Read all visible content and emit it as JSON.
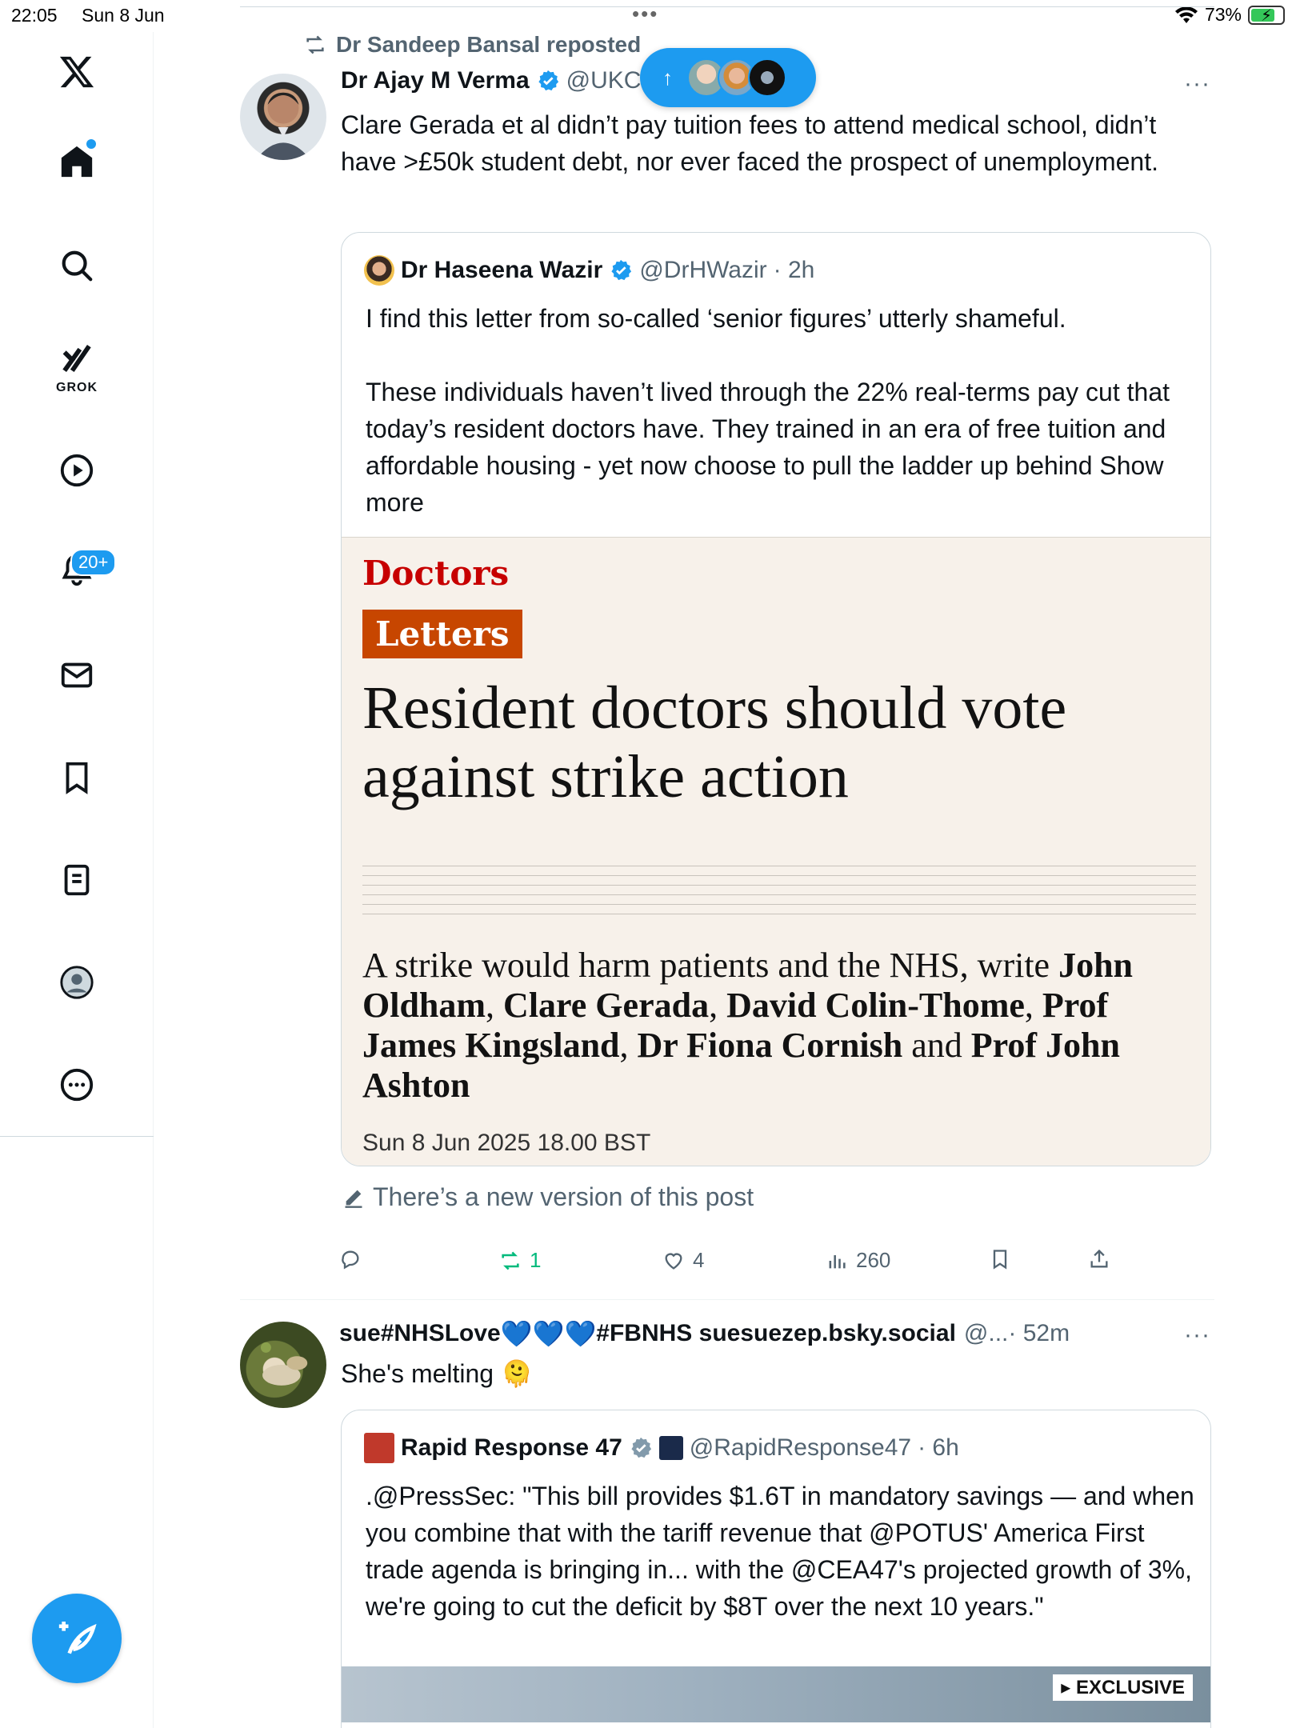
{
  "status_bar": {
    "time": "22:05",
    "date": "Sun 8 Jun",
    "battery": "73%"
  },
  "sidebar": {
    "grok_label": "GROK",
    "notifications_badge": "20+"
  },
  "new_posts_pill": {
    "arrow": "↑"
  },
  "post1": {
    "repost_label": "Dr Sandeep Bansal reposted",
    "author_name": "Dr Ajay M Verma",
    "author_handle": "@UKC",
    "more": "···",
    "text": "Clare Gerada et al didn’t pay tuition fees to attend medical school, didn’t have >£50k student debt, nor ever faced the prospect of unemployment.",
    "quote": {
      "author_name": "Dr Haseena Wazir",
      "author_handle": "@DrHWazir",
      "time": "· 2h",
      "paragraph1": "I find this letter from so-called ‘senior figures’ utterly shameful.",
      "paragraph2": "These individuals haven’t lived through the 22% real-terms pay cut that today’s resident doctors have. They trained in an era of free tuition and affordable housing - yet now choose to pull the ladder up behind",
      "show_more": "Show more",
      "article": {
        "section": "Doctors",
        "tag": "Letters",
        "headline": "Resident doctors should vote against strike action",
        "standfirst_lead": "A strike would harm patients and the NHS, write",
        "authors": [
          "John Oldham",
          "Clare Gerada",
          "David Colin-Thome",
          "Prof James Kingsland",
          "Dr Fiona Cornish",
          "Prof John Ashton"
        ],
        "joiner_comma": ",",
        "joiner_and": "and",
        "date": "Sun 8 Jun 2025 18.00 BST"
      }
    },
    "edit_note": "There’s a new version of this post",
    "actions": {
      "reposts": "1",
      "likes": "4",
      "views": "260"
    }
  },
  "post2": {
    "author_name_prefix": "sue#NHSLove",
    "author_name_suffix": "#FBNHS suesuezep.bsky.social",
    "author_handle": "@...",
    "time": "· 52m",
    "more": "···",
    "text": "She's melting",
    "emoji": "🫠",
    "quote": {
      "author_name": "Rapid Response 47",
      "author_handle": "@RapidResponse47",
      "time": "· 6h",
      "text": ".@PressSec: \"This bill provides $1.6T in mandatory savings — and when you combine that with the tariff revenue that @POTUS' America First trade agenda is bringing in... with the @CEA47's projected growth of 3%, we're going to cut the deficit by $8T over the next 10 years.\"",
      "media_badge": "▸ EXCLUSIVE"
    }
  },
  "colors": {
    "accent": "#1d9bf0",
    "repost_green": "#00ba7c",
    "guardian_red": "#c70000",
    "letters_orange": "#c74600"
  }
}
